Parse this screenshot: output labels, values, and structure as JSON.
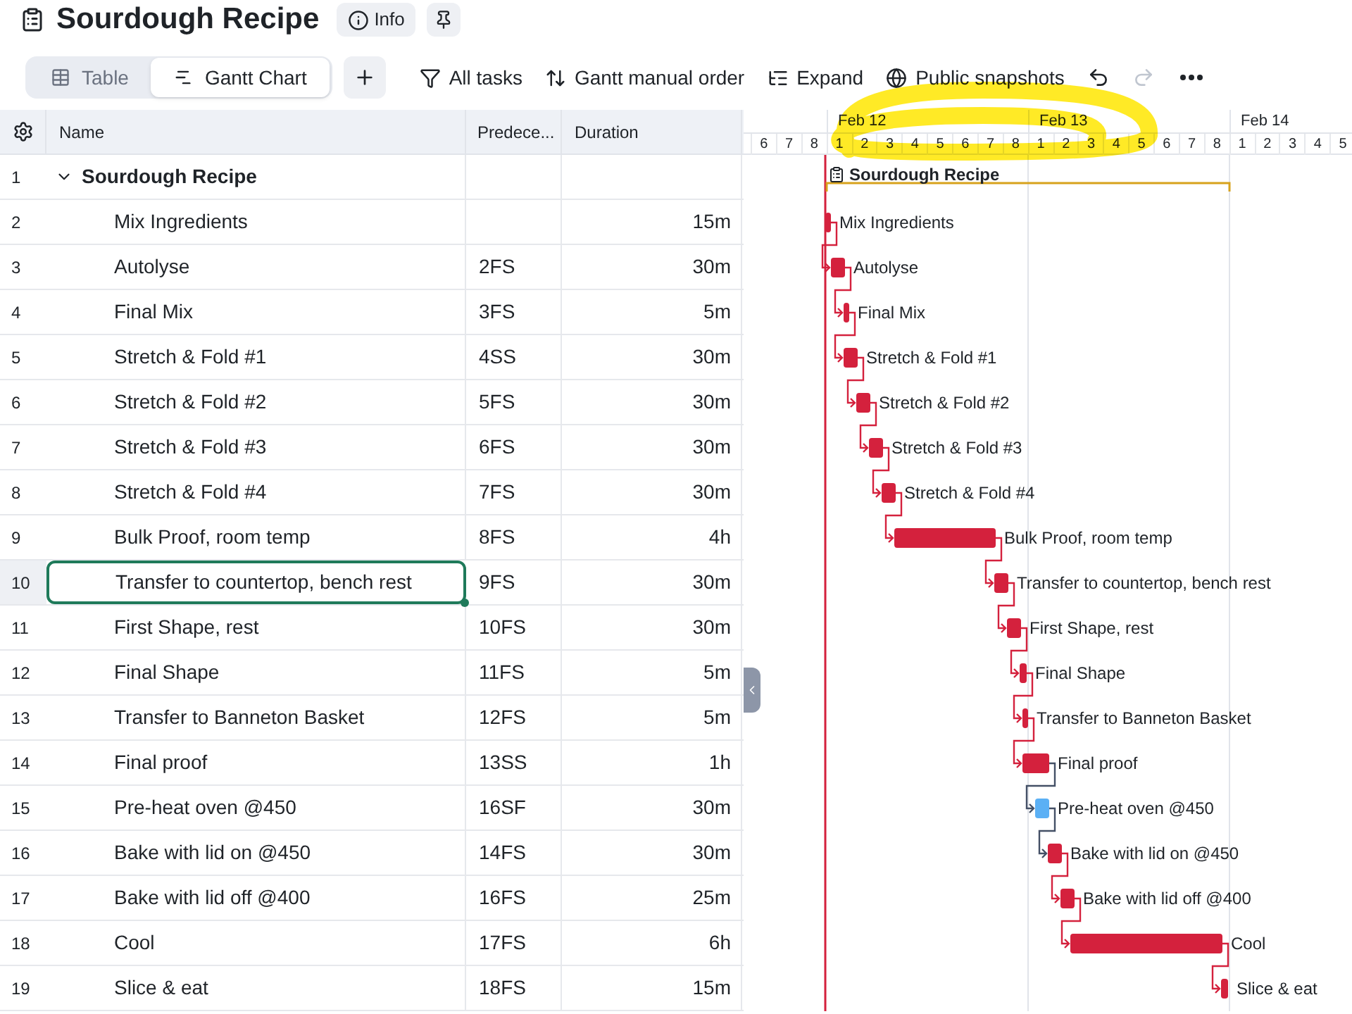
{
  "document": {
    "title": "Sourdough Recipe",
    "info_button": "Info"
  },
  "views": [
    {
      "label": "Table",
      "selected": false
    },
    {
      "label": "Gantt Chart",
      "selected": true
    }
  ],
  "toolbar": [
    {
      "kind": "filter",
      "label": "All tasks"
    },
    {
      "kind": "sort",
      "label": "Gantt manual order"
    },
    {
      "kind": "expand",
      "label": "Expand"
    },
    {
      "kind": "globe",
      "label": "Public snapshots"
    }
  ],
  "history": {
    "undo": {
      "disabled": false
    },
    "redo": {
      "disabled": true
    }
  },
  "table": {
    "columns": [
      "Name",
      "Predece...",
      "Duration"
    ],
    "rows": [
      {
        "number": "1",
        "name": "Sourdough Recipe",
        "selected": false,
        "expanded": true,
        "children": [
          {
            "number": "2",
            "name": "Mix Ingredients",
            "duration": "15m",
            "selected": false
          },
          {
            "number": "3",
            "name": "Autolyse",
            "predecessors": "2FS",
            "duration": "30m",
            "selected": false
          },
          {
            "number": "4",
            "name": "Final Mix",
            "predecessors": "3FS",
            "duration": "5m",
            "selected": false
          },
          {
            "number": "5",
            "name": "Stretch & Fold #1",
            "predecessors": "4SS",
            "duration": "30m",
            "selected": false
          },
          {
            "number": "6",
            "name": "Stretch & Fold #2",
            "predecessors": "5FS",
            "duration": "30m",
            "selected": false
          },
          {
            "number": "7",
            "name": "Stretch & Fold #3",
            "predecessors": "6FS",
            "duration": "30m",
            "selected": false
          },
          {
            "number": "8",
            "name": "Stretch & Fold #4",
            "predecessors": "7FS",
            "duration": "30m",
            "selected": false
          },
          {
            "number": "9",
            "name": "Bulk Proof, room temp",
            "predecessors": "8FS",
            "duration": "4h",
            "selected": false
          },
          {
            "number": "10",
            "name": "Transfer to countertop, bench rest",
            "predecessors": "9FS",
            "duration": "30m",
            "selected": true
          },
          {
            "number": "11",
            "name": "First Shape, rest",
            "predecessors": "10FS",
            "duration": "30m",
            "selected": false
          },
          {
            "number": "12",
            "name": "Final Shape",
            "predecessors": "11FS",
            "duration": "5m",
            "selected": false
          },
          {
            "number": "13",
            "name": "Transfer to Banneton Basket",
            "predecessors": "12FS",
            "duration": "5m",
            "selected": false
          },
          {
            "number": "14",
            "name": "Final proof",
            "predecessors": "13SS",
            "duration": "1h",
            "selected": false
          },
          {
            "number": "15",
            "name": "Pre-heat oven @450",
            "predecessors": "16SF",
            "duration": "30m",
            "selected": false
          },
          {
            "number": "16",
            "name": "Bake with lid on @450",
            "predecessors": "14FS",
            "duration": "30m",
            "selected": false
          },
          {
            "number": "17",
            "name": "Bake with lid off @400",
            "predecessors": "16FS",
            "duration": "25m",
            "selected": false
          },
          {
            "number": "18",
            "name": "Cool",
            "predecessors": "17FS",
            "duration": "6h",
            "selected": false
          },
          {
            "number": "19",
            "name": "Slice & eat",
            "predecessors": "18FS",
            "duration": "15m",
            "selected": false
          }
        ]
      }
    ]
  },
  "gantt": {
    "days": [
      "Feb 12",
      "Feb 13",
      "Feb 14"
    ],
    "hours": [
      "6",
      "7",
      "8",
      "1",
      "2",
      "3",
      "4",
      "5",
      "6",
      "7",
      "8",
      "1",
      "2",
      "3",
      "4",
      "5",
      "6",
      "7",
      "8",
      "1",
      "2",
      "3",
      "4",
      "5"
    ],
    "summary": {
      "label": "Sourdough Recipe"
    },
    "bars": [
      {
        "label": "Mix Ingredients",
        "color": "#d4213d"
      },
      {
        "label": "Autolyse",
        "color": "#d4213d"
      },
      {
        "label": "Final Mix",
        "color": "#d4213d"
      },
      {
        "label": "Stretch & Fold #1",
        "color": "#d4213d"
      },
      {
        "label": "Stretch & Fold #2",
        "color": "#d4213d"
      },
      {
        "label": "Stretch & Fold #3",
        "color": "#d4213d"
      },
      {
        "label": "Stretch & Fold #4",
        "color": "#d4213d"
      },
      {
        "label": "Bulk Proof, room temp",
        "color": "#d4213d"
      },
      {
        "label": "Transfer to countertop, bench rest",
        "color": "#d4213d"
      },
      {
        "label": "First Shape, rest",
        "color": "#d4213d"
      },
      {
        "label": "Final Shape",
        "color": "#d4213d"
      },
      {
        "label": "Transfer to Banneton Basket",
        "color": "#d4213d"
      },
      {
        "label": "Final proof",
        "color": "#d4213d"
      },
      {
        "label": "Pre-heat oven @450",
        "color": "#5bb0f5"
      },
      {
        "label": "Bake with lid on @450",
        "color": "#d4213d"
      },
      {
        "label": "Bake with lid off @400",
        "color": "#d4213d"
      },
      {
        "label": "Cool",
        "color": "#d4213d"
      },
      {
        "label": "Slice & eat",
        "color": "#d4213d"
      }
    ]
  }
}
